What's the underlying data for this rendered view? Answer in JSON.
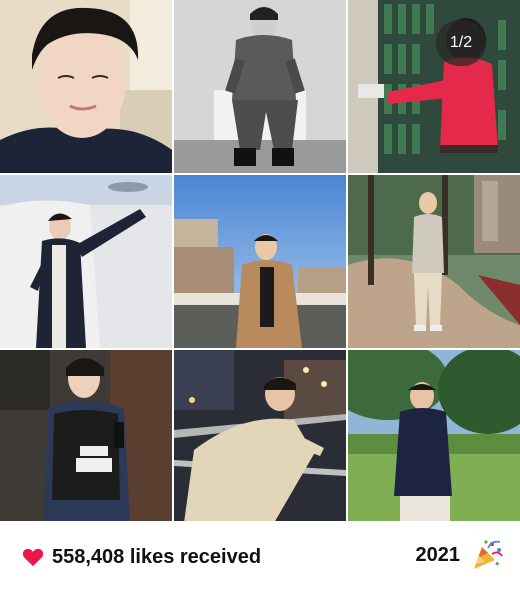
{
  "gallery": {
    "page_indicator": "1/2",
    "photos": [
      {
        "label": "selfie-portrait"
      },
      {
        "label": "military-uniform-bw"
      },
      {
        "label": "red-jumpsuit-costume"
      },
      {
        "label": "navy-coat-pointing"
      },
      {
        "label": "camel-coat-sunset-city"
      },
      {
        "label": "park-path-knit"
      },
      {
        "label": "police-uniform"
      },
      {
        "label": "night-bridge-railing"
      },
      {
        "label": "navy-sweater-garden"
      }
    ]
  },
  "footer": {
    "heart_icon": "heart-icon",
    "likes_text": "558,408 likes received",
    "year": "2021",
    "party_icon": "party-popper-icon"
  },
  "colors": {
    "heart": "#e8194a",
    "text": "#111111"
  }
}
